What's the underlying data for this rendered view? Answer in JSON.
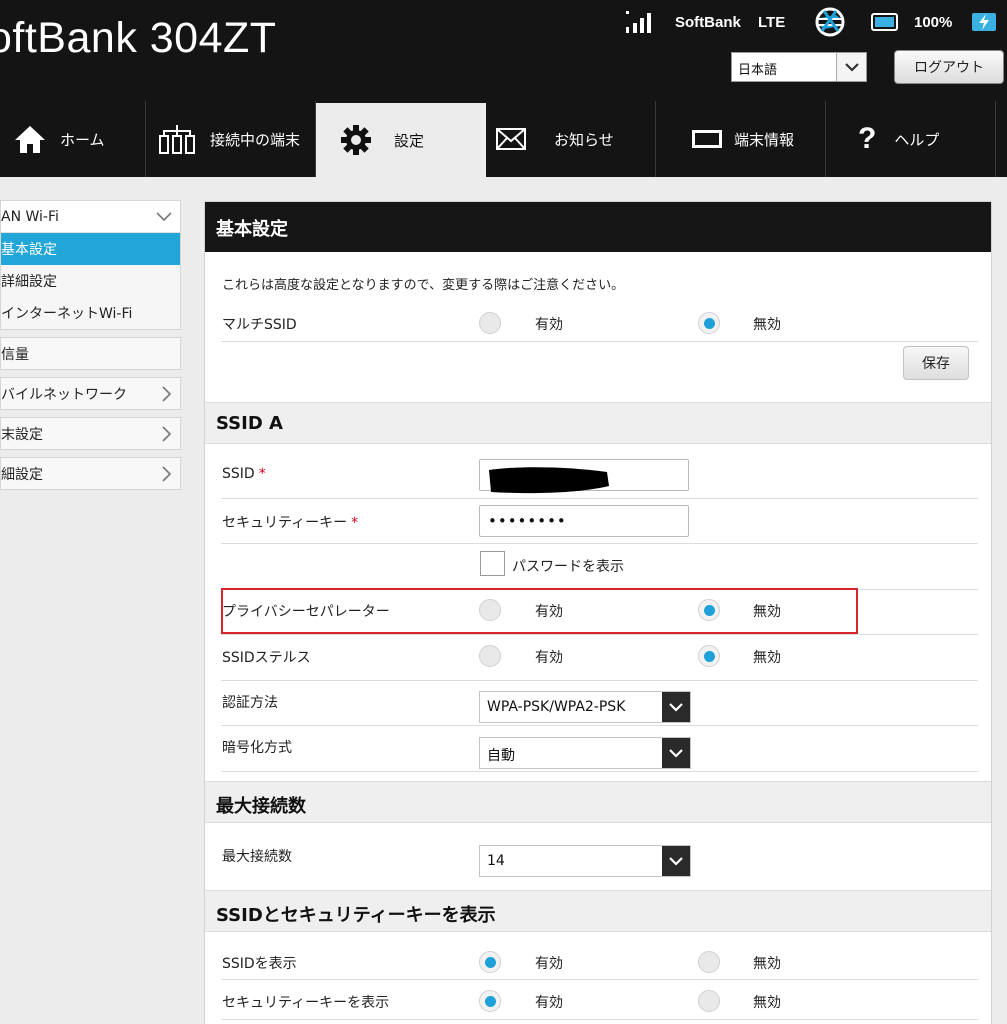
{
  "header": {
    "brand": "oftBank 304ZT",
    "carrier": "SoftBank",
    "network_type": "LTE",
    "battery": "100%",
    "language_value": "日本語",
    "logout_label": "ログアウト"
  },
  "nav": {
    "items": [
      {
        "label": "ホーム",
        "icon": "home-icon"
      },
      {
        "label": "接続中の端末",
        "icon": "devices-icon"
      },
      {
        "label": "設定",
        "icon": "gear-icon"
      },
      {
        "label": "お知らせ",
        "icon": "mail-icon"
      },
      {
        "label": "端末情報",
        "icon": "display-icon"
      },
      {
        "label": "ヘルプ",
        "icon": "help-icon"
      }
    ],
    "active": "設定"
  },
  "sidebar": {
    "group_title": "AN Wi-Fi",
    "sub_items": [
      "基本設定",
      "詳細設定",
      "インターネットWi-Fi"
    ],
    "selected": "基本設定",
    "items": [
      "信量",
      "バイルネットワーク",
      "末設定",
      "細設定"
    ]
  },
  "main": {
    "basic": {
      "title": "基本設定",
      "note": "これらは高度な設定となりますので、変更する際はご注意ください。",
      "multi_ssid_label": "マルチSSID",
      "save_label": "保存"
    },
    "ssid_a": {
      "title": "SSID A",
      "ssid_label": "SSID",
      "required_mark": "*",
      "security_key_label": "セキュリティーキー",
      "security_key_value": "••••••••",
      "show_password_label": "パスワードを表示",
      "privacy_separator_label": "プライバシーセパレーター",
      "ssid_stealth_label": "SSIDステルス",
      "auth_method_label": "認証方法",
      "auth_method_value": "WPA-PSK/WPA2-PSK",
      "encryption_label": "暗号化方式",
      "encryption_value": "自動"
    },
    "max_conn": {
      "title": "最大接続数",
      "label": "最大接続数",
      "value": "14"
    },
    "display": {
      "title": "SSIDとセキュリティーキーを表示",
      "show_ssid_label": "SSIDを表示",
      "show_key_label": "セキュリティーキーを表示"
    },
    "enable_label": "有効",
    "disable_label": "無効"
  },
  "colors": {
    "header_bg": "#141414",
    "accent_blue": "#22a6d8",
    "highlight_red": "#d6262c"
  }
}
